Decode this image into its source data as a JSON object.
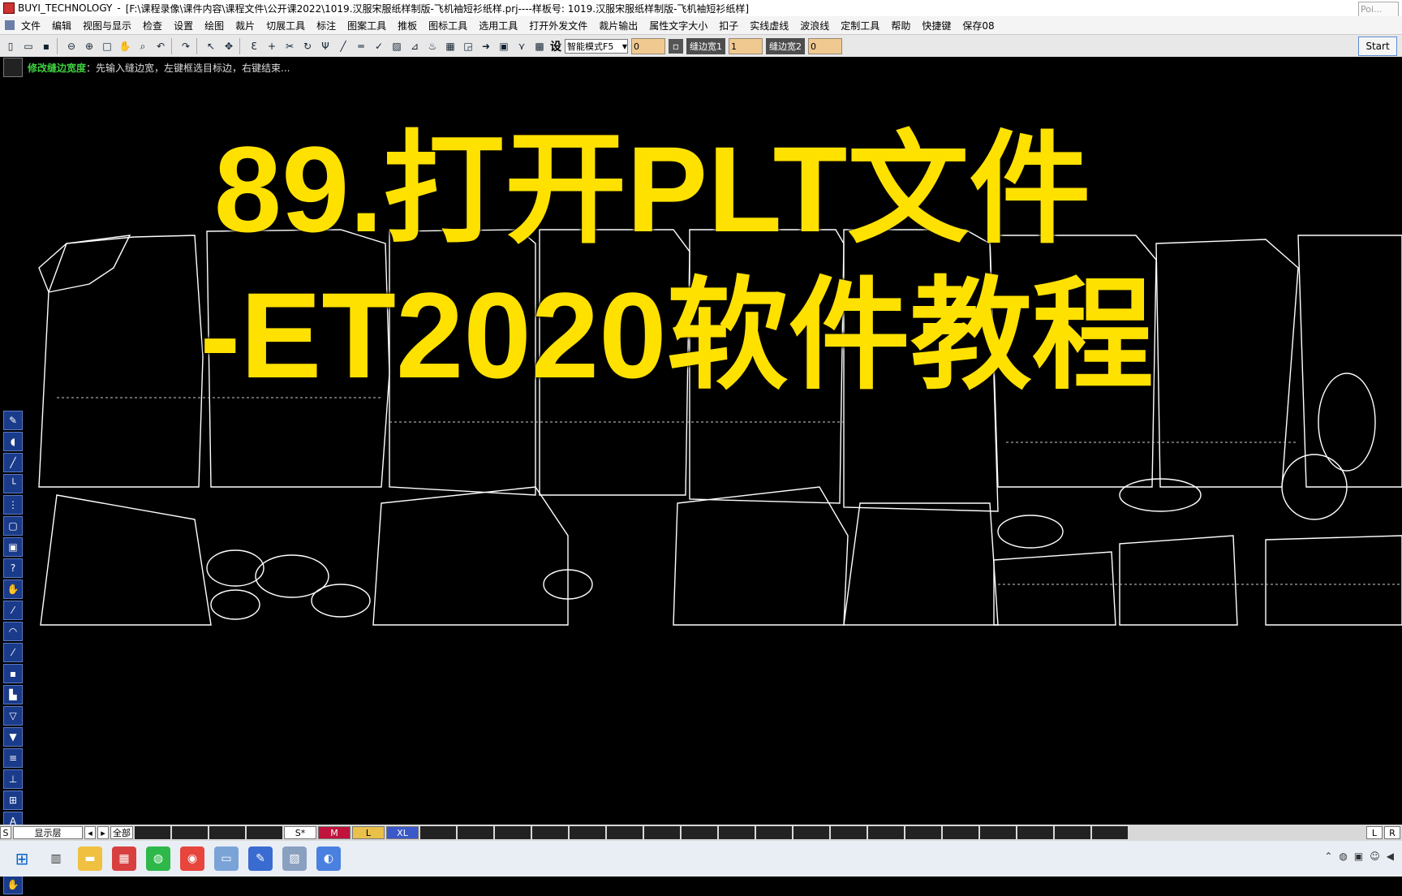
{
  "window": {
    "app_name": "BUYI_TECHNOLOGY",
    "title_path": "[F:\\课程录像\\课件内容\\课程文件\\公开课2022\\1019.汉服宋服纸样制版-飞机袖短衫纸样.prj----样板号: 1019.汉服宋服纸样制版-飞机袖短衫纸样]",
    "corner_box_text": "Poi..."
  },
  "menu": [
    "文件",
    "编辑",
    "视图与显示",
    "检查",
    "设置",
    "绘图",
    "裁片",
    "切展工具",
    "标注",
    "图案工具",
    "推板",
    "图标工具",
    "选用工具",
    "打开外发文件",
    "裁片输出",
    "属性文字大小",
    "扣子",
    "实线虚线",
    "波浪线",
    "定制工具",
    "帮助",
    "快捷键",
    "保存08"
  ],
  "toolbar": {
    "settings_char": "设",
    "mode_value": "智能模式F5",
    "field_a": "0",
    "seam_width1_label": "缝边宽1",
    "seam_width1_value": "1",
    "seam_width2_label": "缝边宽2",
    "seam_width2_value": "0",
    "start_label": "Start"
  },
  "status": {
    "label": "修改缝边宽度",
    "text": "：先输入缝边宽，左键框选目标边，右键结束..."
  },
  "overlay": {
    "line1": "89.打开PLT文件",
    "line2": "-ET2020软件教程"
  },
  "left_tools": [
    "pen-icon",
    "arc-icon",
    "line-icon",
    "corner-icon",
    "measure-icon",
    "frame-icon",
    "frame2-icon",
    "help-icon",
    "hand-icon",
    "slope-icon",
    "curve-icon",
    "slope2-icon",
    "save-icon",
    "grade-icon",
    "notch-icon",
    "notch2-icon",
    "align-icon",
    "dim-icon",
    "ruler-icon",
    "text-icon",
    "button-icon",
    "button2-icon",
    "hand2-icon"
  ],
  "layerbar": {
    "s_label": "S",
    "layer_label": "显示层",
    "all_label": "全部",
    "sizes": [
      {
        "label": "S*",
        "color": "#ffffff"
      },
      {
        "label": "M",
        "color": "#c0143c"
      },
      {
        "label": "L",
        "color": "#e8c04a"
      },
      {
        "label": "XL",
        "color": "#3a58c8"
      }
    ],
    "right_l": "L",
    "right_r": "R"
  },
  "colors": {
    "overlay_text": "#ffe100",
    "canvas_bg": "#000000",
    "pattern_lines": "#ffffff",
    "status_label": "#3fd23f"
  }
}
